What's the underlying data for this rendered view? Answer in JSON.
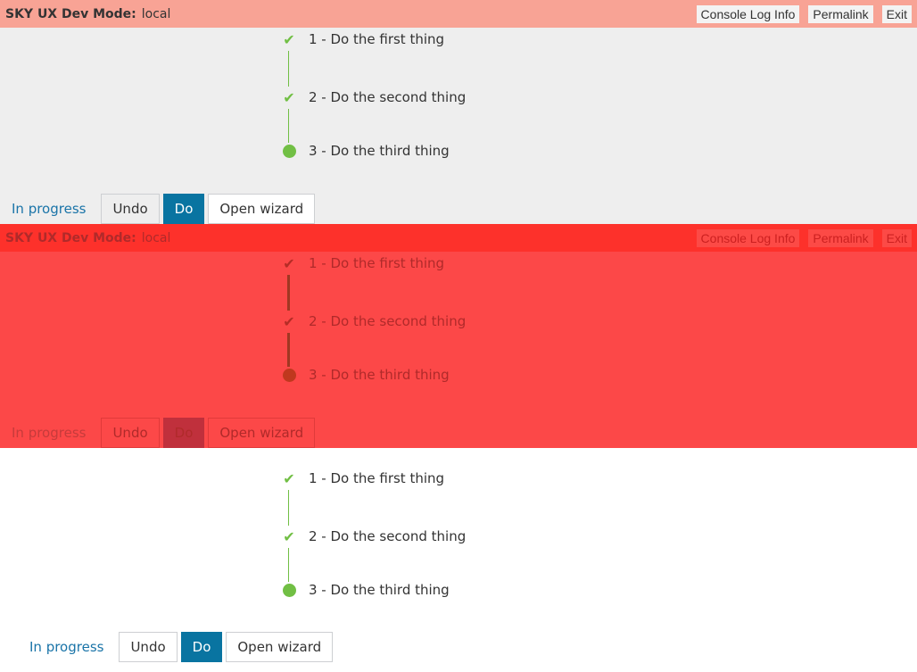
{
  "devbar": {
    "label": "SKY UX Dev Mode:",
    "mode": "local",
    "actions": [
      "Console Log Info",
      "Permalink",
      "Exit"
    ]
  },
  "wizard": {
    "steps": [
      {
        "label": "1 - Do the first thing",
        "state": "complete",
        "icon": "check-icon"
      },
      {
        "label": "2 - Do the second thing",
        "state": "complete",
        "icon": "check-icon"
      },
      {
        "label": "3 - Do the third thing",
        "state": "in-progress",
        "icon": "dot-icon"
      }
    ],
    "status": "In progress",
    "buttons": {
      "undo": "Undo",
      "do": "Do",
      "open": "Open wizard"
    }
  },
  "colors": {
    "accent": "#71bf44",
    "primary": "#0974a1",
    "link": "#1a74a8",
    "devbar": "#f8a395",
    "diff_overlay": "#fc4848"
  }
}
